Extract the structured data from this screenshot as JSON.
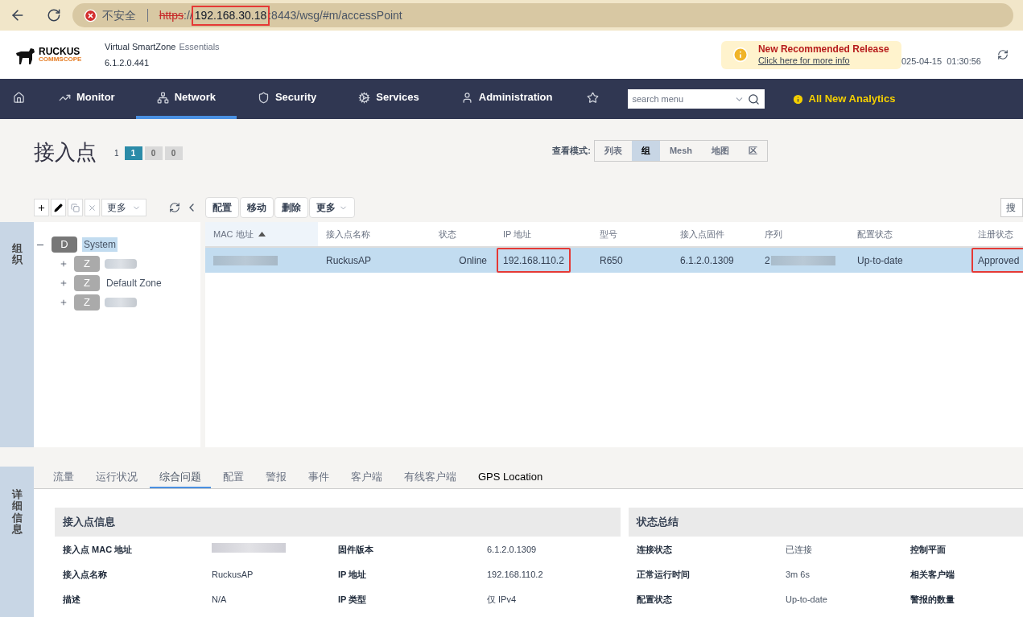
{
  "browser": {
    "security_label": "不安全",
    "url_scheme": "https",
    "url_sep": "://",
    "url_host": "192.168.30.18",
    "url_host_highlighted": true,
    "url_rest": ":8443/wsg/#m/accessPoint"
  },
  "header": {
    "logo_text": "RUCKUS",
    "logo_subtext": "COMMSCOPE",
    "product": "Virtual SmartZone",
    "edition": "Essentials",
    "version": "6.1.2.0.441",
    "notice_title": "New Recommended Release",
    "notice_link": "Click here for more info",
    "datetime": "025-04-15  01:30:56"
  },
  "nav": {
    "items": [
      {
        "kind": "home",
        "selected": false
      },
      {
        "kind": "monitor",
        "label": "Monitor",
        "selected": false
      },
      {
        "kind": "network",
        "label": "Network",
        "selected": true
      },
      {
        "kind": "security",
        "label": "Security",
        "selected": false
      },
      {
        "kind": "services",
        "label": "Services",
        "selected": false
      },
      {
        "kind": "administration",
        "label": "Administration",
        "selected": false
      },
      {
        "kind": "favorites",
        "selected": false
      }
    ],
    "search_placeholder": "search menu",
    "analytics": "All New Analytics"
  },
  "page": {
    "title": "接入点",
    "count": "1",
    "badges": [
      {
        "text": "1",
        "color": "#2b8ba8"
      },
      {
        "text": "0",
        "color": "#d9d9d9"
      },
      {
        "text": "0",
        "color": "#d9d9d9"
      }
    ],
    "view_label": "查看模式:",
    "view_modes": [
      {
        "label": "列表",
        "selected": false
      },
      {
        "label": "组",
        "selected": true
      },
      {
        "label": "Mesh",
        "selected": false
      },
      {
        "label": "地图",
        "selected": false
      },
      {
        "label": "区",
        "selected": false
      }
    ]
  },
  "tree_toolbar": {
    "more": "更多"
  },
  "table_toolbar": {
    "buttons": [
      "配置",
      "移动",
      "删除"
    ],
    "more": "更多",
    "search": "搜"
  },
  "side_tabs": {
    "top": "组织",
    "bottom": "详细信息"
  },
  "tree": {
    "badge": "D",
    "label": "System",
    "expanded": true,
    "selected": true,
    "children": [
      {
        "badge": "Z",
        "expanded": false,
        "selected": false,
        "blurred": true
      },
      {
        "badge": "Z",
        "label": "Default Zone",
        "expanded": false,
        "selected": false,
        "blurred": false
      },
      {
        "badge": "Z",
        "expanded": false,
        "selected": false,
        "blurred": true
      }
    ]
  },
  "table": {
    "columns": [
      {
        "label": "MAC 地址",
        "sorted": true
      },
      {
        "label": "接入点名称",
        "sorted": false
      },
      {
        "label": "状态",
        "sorted": false
      },
      {
        "label": "IP 地址",
        "sorted": false
      },
      {
        "label": "型号",
        "sorted": false
      },
      {
        "label": "接入点固件",
        "sorted": false
      },
      {
        "label": "序列",
        "sorted": false
      },
      {
        "label": "配置状态",
        "sorted": false
      },
      {
        "label": "注册状态",
        "sorted": false
      }
    ],
    "rows": [
      {
        "selected": true,
        "cells": [
          {
            "blurred": true
          },
          {
            "text": "RuckusAP",
            "blurred": false
          },
          {
            "text": "Online",
            "blurred": false
          },
          {
            "text": "192.168.110.2",
            "blurred": false,
            "highlighted": true
          },
          {
            "text": "R650",
            "blurred": false
          },
          {
            "text": "6.1.2.0.1309",
            "blurred": false
          },
          {
            "text": "2",
            "blurred": true
          },
          {
            "text": "Up-to-date",
            "blurred": false
          },
          {
            "text": "Approved",
            "blurred": false,
            "highlighted": true
          }
        ]
      }
    ]
  },
  "detail_tabs": [
    {
      "label": "流量",
      "selected": false
    },
    {
      "label": "运行状况",
      "selected": false
    },
    {
      "label": "综合问题",
      "selected": true
    },
    {
      "label": "配置",
      "selected": false
    },
    {
      "label": "警报",
      "selected": false
    },
    {
      "label": "事件",
      "selected": false
    },
    {
      "label": "客户端",
      "selected": false
    },
    {
      "label": "有线客户端",
      "selected": false
    },
    {
      "label": "GPS Location",
      "selected": false
    }
  ],
  "ap_info": {
    "title": "接入点信息",
    "rows": [
      [
        {
          "label": "接入点 MAC 地址",
          "blurred": true
        },
        {
          "label": "固件版本",
          "value": "6.1.2.0.1309",
          "blurred": false
        }
      ],
      [
        {
          "label": "接入点名称",
          "value": "RuckusAP",
          "blurred": false
        },
        {
          "label": "IP 地址",
          "value": "192.168.110.2",
          "blurred": false
        }
      ],
      [
        {
          "label": "描述",
          "value": "N/A",
          "blurred": false
        },
        {
          "label": "IP 类型",
          "value": "仅 IPv4",
          "blurred": false
        }
      ]
    ]
  },
  "status_summary": {
    "title": "状态总结",
    "rows": [
      {
        "label": "连接状态",
        "value": "已连接",
        "label2": "控制平面"
      },
      {
        "label": "正常运行时间",
        "value": "3m 6s",
        "label2": "相关客户端"
      },
      {
        "label": "配置状态",
        "value": "Up-to-date",
        "label2": "警报的数量"
      }
    ]
  }
}
